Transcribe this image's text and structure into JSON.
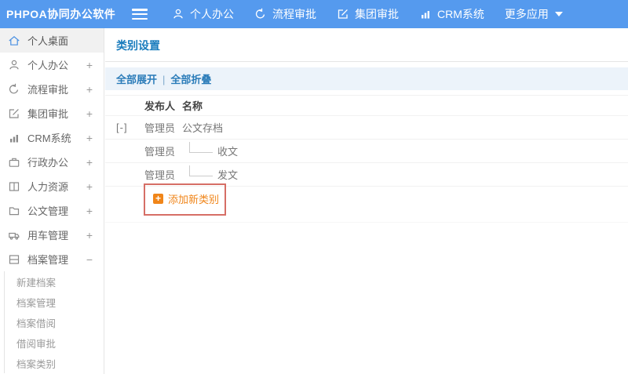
{
  "topbar": {
    "logo": "PHPOA协同办公软件",
    "nav": [
      {
        "label": "个人办公",
        "icon": "user-icon"
      },
      {
        "label": "流程审批",
        "icon": "flow-icon"
      },
      {
        "label": "集团审批",
        "icon": "edit-square-icon"
      },
      {
        "label": "CRM系统",
        "icon": "bar-chart-icon"
      },
      {
        "label": "更多应用",
        "icon": "caret-down-icon"
      }
    ]
  },
  "sidebar": {
    "items": [
      {
        "label": "个人桌面",
        "icon": "home-icon",
        "expand": "",
        "active": true
      },
      {
        "label": "个人办公",
        "icon": "user-icon",
        "expand": "+"
      },
      {
        "label": "流程审批",
        "icon": "flow-icon",
        "expand": "+"
      },
      {
        "label": "集团审批",
        "icon": "edit-square-icon",
        "expand": "+"
      },
      {
        "label": "CRM系统",
        "icon": "bar-chart-icon",
        "expand": "+"
      },
      {
        "label": "行政办公",
        "icon": "briefcase-icon",
        "expand": "+"
      },
      {
        "label": "人力资源",
        "icon": "book-icon",
        "expand": "+"
      },
      {
        "label": "公文管理",
        "icon": "folder-icon",
        "expand": "+"
      },
      {
        "label": "用车管理",
        "icon": "truck-icon",
        "expand": "+"
      },
      {
        "label": "档案管理",
        "icon": "archive-icon",
        "expand": "−"
      }
    ],
    "subitems": [
      {
        "label": "新建档案"
      },
      {
        "label": "档案管理"
      },
      {
        "label": "档案借阅"
      },
      {
        "label": "借阅审批"
      },
      {
        "label": "档案类别"
      }
    ]
  },
  "main": {
    "title": "类别设置",
    "toolbar": {
      "expand_all": "全部展开",
      "divider": "|",
      "collapse_all": "全部折叠"
    },
    "table": {
      "headers": {
        "publisher": "发布人",
        "name": "名称"
      },
      "rows": [
        {
          "toggle": "[-]",
          "publisher": "管理员",
          "name": "公文存档"
        },
        {
          "toggle": "",
          "publisher": "管理员",
          "name": "收文"
        },
        {
          "toggle": "",
          "publisher": "管理员",
          "name": "发文"
        }
      ]
    },
    "add_button": {
      "plus": "+",
      "label": "添加新类别"
    }
  },
  "colors": {
    "topbar_blue": "#559AEE",
    "title_blue": "#1A7CBD",
    "toolbar_bg": "#ECF3FA",
    "accent_orange": "#F08519",
    "highlight_red": "#D66E66",
    "active_item_bg": "#F1F1F1"
  }
}
